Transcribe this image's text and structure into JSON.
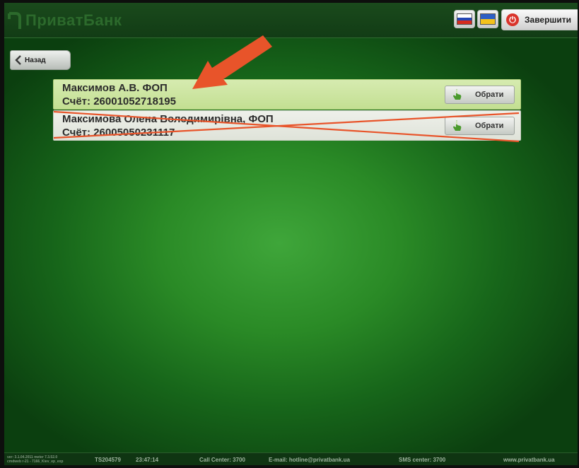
{
  "header": {
    "logo_text": "ПриватБанк",
    "exit_label": "Завершити",
    "languages": [
      "ru",
      "ua"
    ]
  },
  "nav": {
    "back_label": "Назад"
  },
  "accounts": [
    {
      "name": "Максимов А.В. ФОП",
      "account": "Счёт: 26001052718195",
      "choose_label": "Обрати"
    },
    {
      "name": "Максимова Олена Володимирівна, ФОП",
      "account": "Счёт: 26005050231117",
      "choose_label": "Обрати"
    }
  ],
  "footer": {
    "version_line1": "ver: 3.1.04.2011  meter 7.3.52.0",
    "version_line2": "cmdweb r-21 - 7166_Kiev_ep_exp",
    "terminal": "TS204579",
    "time": "23:47:14",
    "call_center": "Call Center: 3700",
    "email": "E-mail: hotline@privatbank.ua",
    "sms_center": "SMS center: 3700",
    "website": "www.privatbank.ua"
  },
  "colors": {
    "annotation": "#e8542a",
    "selected_row": "#c8e29a",
    "background_green": "#2a8a26"
  },
  "icons": {
    "back": "chevron-left-icon",
    "choose": "hand-pointer-icon",
    "exit": "power-icon"
  }
}
